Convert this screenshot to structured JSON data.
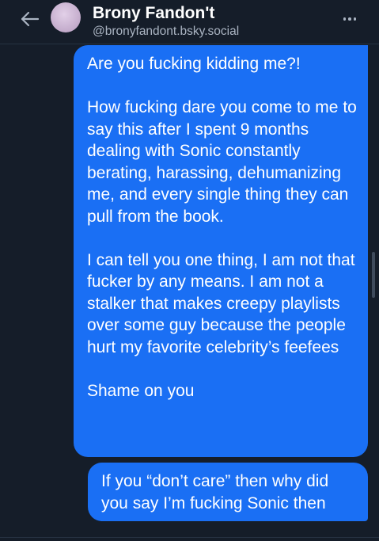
{
  "header": {
    "back_icon": "arrow-left-icon",
    "display_name": "Brony Fandon't",
    "handle": "@bronyfandont.bsky.social",
    "more_icon": "more-horizontal-icon"
  },
  "messages": [
    {
      "sender": "self",
      "text": "Are you fucking kidding me?!\n\nHow fucking dare you come to me to say this after I spent 9 months dealing with Sonic constantly berating, harassing, dehumanizing me, and every single thing they can pull from the book.\n\nI can tell you one thing, I am not that fucker by any means. I am not a stalker that makes creepy playlists over some guy because the people hurt my favorite celebrity’s feefees\n\nShame on you"
    },
    {
      "sender": "self",
      "text": "If you “don’t care” then why did you say I’m fucking Sonic then"
    }
  ],
  "colors": {
    "background": "#151d29",
    "bubble": "#1a6ff4",
    "text": "#ffffff",
    "muted": "#aab4c2"
  }
}
